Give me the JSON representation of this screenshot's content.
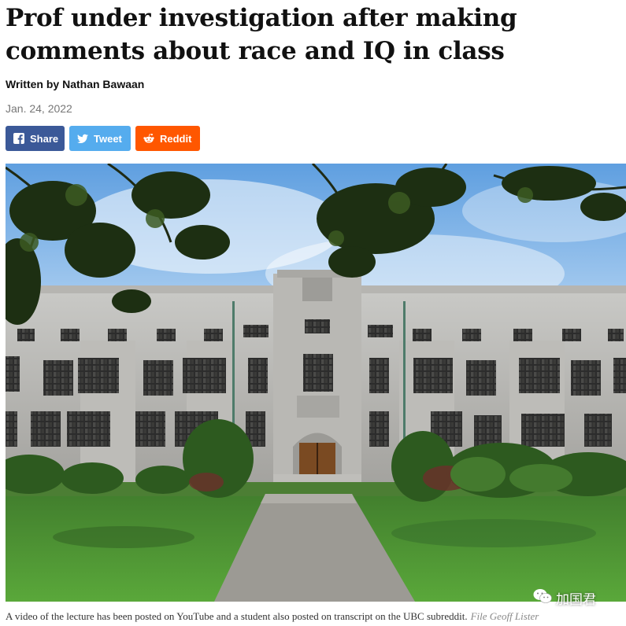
{
  "article": {
    "headline": "Prof under investigation after making comments about race and IQ in class",
    "byline": "Written by Nathan Bawaan",
    "date": "Jan. 24, 2022"
  },
  "share_buttons": [
    {
      "label": "Share",
      "icon": "facebook-icon",
      "color": "#3b5998"
    },
    {
      "label": "Tweet",
      "icon": "twitter-icon",
      "color": "#55acee"
    },
    {
      "label": "Reddit",
      "icon": "reddit-icon",
      "color": "#ff5700"
    }
  ],
  "image": {
    "caption": "A video of the lecture has been posted on YouTube and a student also posted on transcript on the UBC subreddit.",
    "credit": "File Geoff Lister"
  },
  "watermark": {
    "text": "加国君",
    "icon": "wechat-icon"
  }
}
